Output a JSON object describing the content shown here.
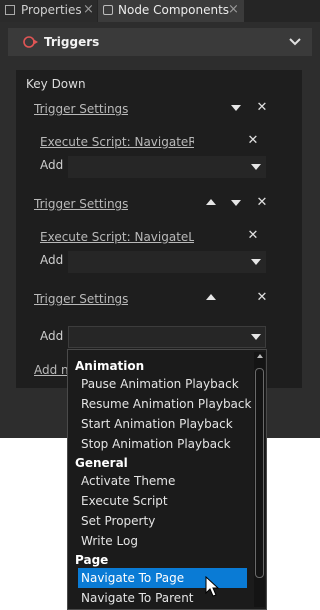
{
  "tabs": [
    {
      "label": "Properties",
      "active": false
    },
    {
      "label": "Node Components",
      "active": true
    }
  ],
  "icons": {
    "properties_tab": "properties-icon",
    "components_tab": "node-components-icon",
    "triggers": "trigger-icon",
    "collapse": "chevron-down-icon",
    "remove": "close-icon",
    "move_up": "arrow-up-icon",
    "move_down": "arrow-down-icon",
    "dropdown": "dropdown-arrow-icon",
    "cursor": "mouse-pointer-icon"
  },
  "section": {
    "title": "Triggers"
  },
  "trigger": {
    "name": "Key Down"
  },
  "settings_blocks": [
    {
      "label": "Trigger Settings",
      "action": "Execute Script: NavigateRigh",
      "add_label": "Add"
    },
    {
      "label": "Trigger Settings",
      "action": "Execute Script: NavigateLeft,",
      "add_label": "Add"
    },
    {
      "label": "Trigger Settings",
      "add_label": "Add"
    }
  ],
  "add_new_label": "Add ne",
  "menu": {
    "groups": [
      {
        "label": "Animation",
        "items": [
          "Pause Animation Playback",
          "Resume Animation Playback",
          "Start Animation Playback",
          "Stop Animation Playback"
        ]
      },
      {
        "label": "General",
        "items": [
          "Activate Theme",
          "Execute Script",
          "Set Property",
          "Write Log"
        ]
      },
      {
        "label": "Page",
        "items": [
          "Navigate To Page",
          "Navigate To Parent"
        ]
      }
    ],
    "selected": "Navigate To Page"
  },
  "colors": {
    "panel_bg": "#2d2d2d",
    "header_bg": "#3a3a3a",
    "content_bg": "#1e1e1e",
    "selection": "#0a7bd5",
    "menu_bg": "#1b1b1b"
  }
}
